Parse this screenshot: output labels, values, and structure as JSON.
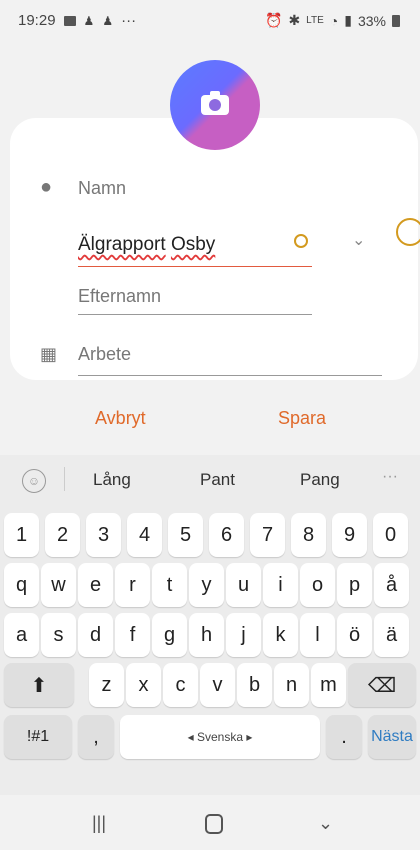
{
  "status": {
    "time": "19:29",
    "more": "···",
    "battery": "33%"
  },
  "contact": {
    "name_label": "Namn",
    "first_name_value_1": "Älgrapport",
    "first_name_value_2": "Osby",
    "lastname_placeholder": "Efternamn",
    "work_label": "Arbete"
  },
  "actions": {
    "cancel": "Avbryt",
    "save": "Spara"
  },
  "keyboard": {
    "suggestions": [
      "Lång",
      "Pant",
      "Pang"
    ],
    "more": "···",
    "row_numbers": [
      "1",
      "2",
      "3",
      "4",
      "5",
      "6",
      "7",
      "8",
      "9",
      "0"
    ],
    "row_1": [
      "q",
      "w",
      "e",
      "r",
      "t",
      "y",
      "u",
      "i",
      "o",
      "p",
      "å"
    ],
    "row_2": [
      "a",
      "s",
      "d",
      "f",
      "g",
      "h",
      "j",
      "k",
      "l",
      "ö",
      "ä"
    ],
    "row_3": [
      "z",
      "x",
      "c",
      "v",
      "b",
      "n",
      "m"
    ],
    "bottom": {
      "symbols": "!#1",
      "comma": ",",
      "space": "◂ Svenska ▸",
      "dot": ".",
      "next": "Nästa"
    }
  },
  "icons": {
    "camera": "camera-icon",
    "person": "person-icon",
    "work": "building-icon",
    "shift": "shift-icon",
    "backspace": "backspace-icon"
  }
}
